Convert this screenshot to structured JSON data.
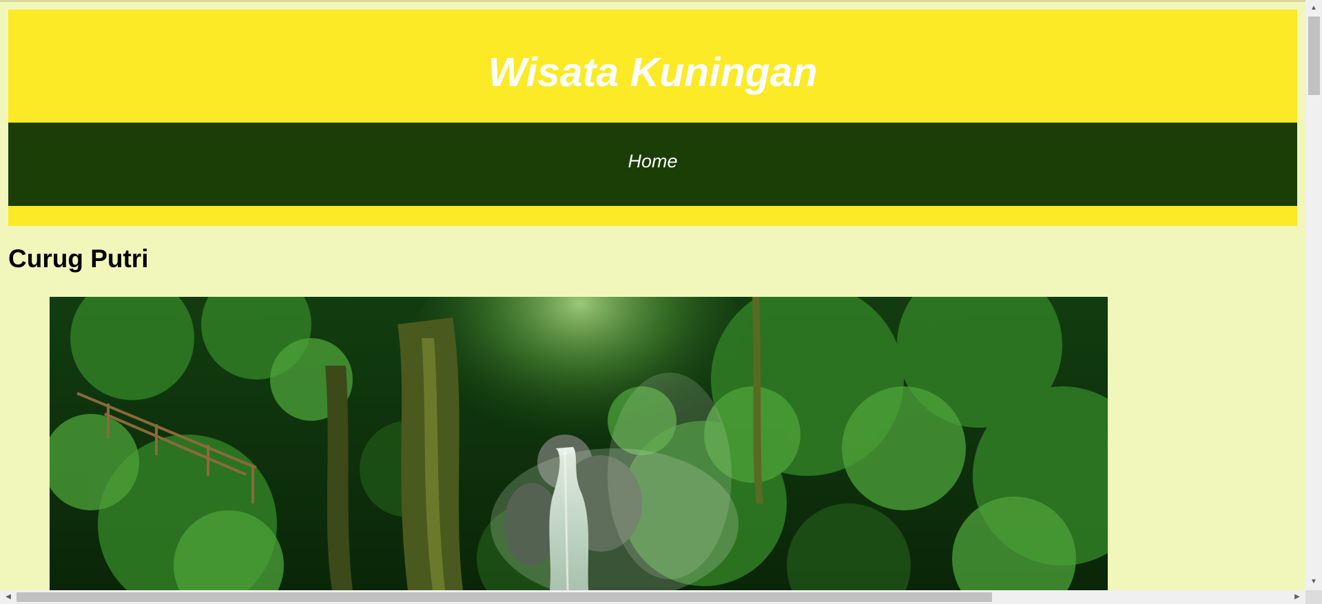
{
  "header": {
    "title": "Wisata Kuningan"
  },
  "nav": {
    "items": [
      {
        "label": "Home"
      }
    ]
  },
  "main": {
    "heading": "Curug Putri",
    "image": {
      "subject": "waterfall in tropical forest"
    }
  },
  "colors": {
    "page_background": "#f1f7bb",
    "header_background": "#fbea25",
    "nav_background": "#1a3e06",
    "header_text": "#ffffff"
  },
  "icons": {
    "scroll_up": "scroll-up-arrow-icon",
    "scroll_down": "scroll-down-arrow-icon",
    "scroll_left": "scroll-left-arrow-icon",
    "scroll_right": "scroll-right-arrow-icon"
  }
}
